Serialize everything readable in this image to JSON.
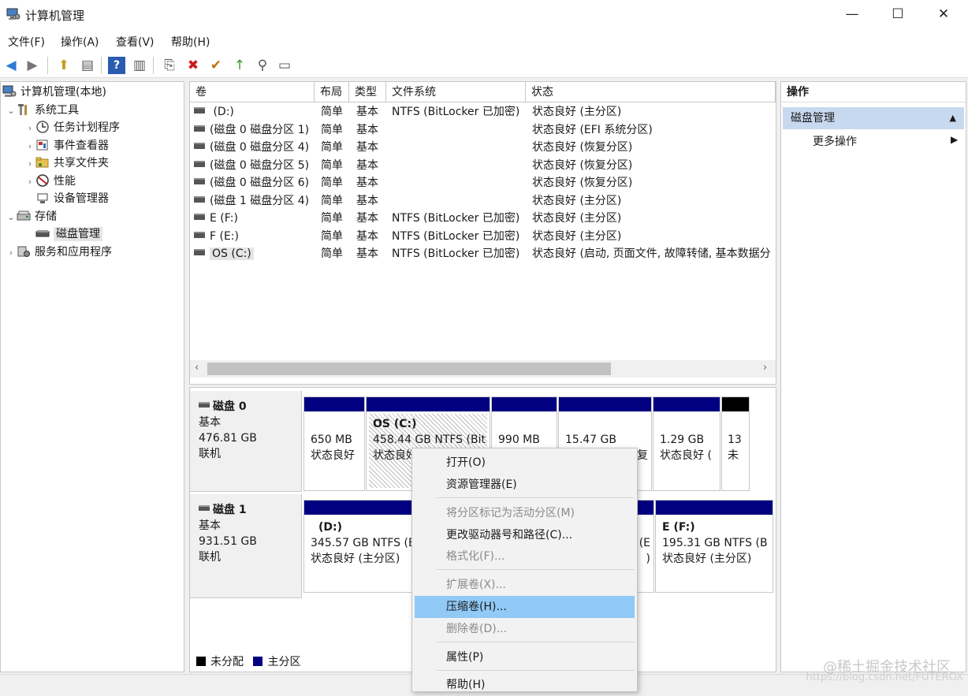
{
  "window": {
    "title": "计算机管理",
    "minimize": "—",
    "maximize": "☐",
    "close": "✕"
  },
  "menu": [
    "文件(F)",
    "操作(A)",
    "查看(V)",
    "帮助(H)"
  ],
  "toolbar": {
    "back": "◀",
    "forward": "▶",
    "up": "⬆",
    "show_hide": "▤",
    "help": "?",
    "view": "▥",
    "connect": "⎘",
    "delete": "✖",
    "properties": "✔",
    "export": "↑",
    "search": "⚲",
    "more": "▭"
  },
  "tree": {
    "root": "计算机管理(本地)",
    "system_tools": "系统工具",
    "task_scheduler": "任务计划程序",
    "event_viewer": "事件查看器",
    "shared_folders": "共享文件夹",
    "performance": "性能",
    "device_manager": "设备管理器",
    "storage": "存储",
    "disk_management": "磁盘管理",
    "services": "服务和应用程序"
  },
  "columns": [
    "卷",
    "布局",
    "类型",
    "文件系统",
    "状态"
  ],
  "volumes": [
    {
      "name": " (D:)",
      "layout": "简单",
      "type": "基本",
      "fs": "NTFS (BitLocker 已加密)",
      "status": "状态良好 (主分区)"
    },
    {
      "name": "(磁盘 0 磁盘分区 1)",
      "layout": "简单",
      "type": "基本",
      "fs": "",
      "status": "状态良好 (EFI 系统分区)"
    },
    {
      "name": "(磁盘 0 磁盘分区 4)",
      "layout": "简单",
      "type": "基本",
      "fs": "",
      "status": "状态良好 (恢复分区)"
    },
    {
      "name": "(磁盘 0 磁盘分区 5)",
      "layout": "简单",
      "type": "基本",
      "fs": "",
      "status": "状态良好 (恢复分区)"
    },
    {
      "name": "(磁盘 0 磁盘分区 6)",
      "layout": "简单",
      "type": "基本",
      "fs": "",
      "status": "状态良好 (恢复分区)"
    },
    {
      "name": "(磁盘 1 磁盘分区 4)",
      "layout": "简单",
      "type": "基本",
      "fs": "",
      "status": "状态良好 (主分区)"
    },
    {
      "name": "E (F:)",
      "layout": "简单",
      "type": "基本",
      "fs": "NTFS (BitLocker 已加密)",
      "status": "状态良好 (主分区)"
    },
    {
      "name": "F (E:)",
      "layout": "简单",
      "type": "基本",
      "fs": "NTFS (BitLocker 已加密)",
      "status": "状态良好 (主分区)"
    },
    {
      "name": "OS (C:)",
      "layout": "简单",
      "type": "基本",
      "fs": "NTFS (BitLocker 已加密)",
      "status": "状态良好 (启动, 页面文件, 故障转储, 基本数据分"
    }
  ],
  "disks": [
    {
      "name": "磁盘 0",
      "type": "基本",
      "size": "476.81 GB",
      "state": "联机",
      "partitions": [
        {
          "title": "",
          "line1": "650 MB",
          "line2": "状态良好"
        },
        {
          "title": "OS  (C:)",
          "line1": "458.44 GB NTFS (Bit",
          "line2": "状态良好"
        },
        {
          "title": "",
          "line1": "990 MB",
          "line2": ""
        },
        {
          "title": "",
          "line1": "15.47 GB",
          "line2": "复"
        },
        {
          "title": "",
          "line1": "1.29 GB",
          "line2": "状态良好 ("
        },
        {
          "title": "",
          "line1": "13",
          "line2": "未"
        }
      ]
    },
    {
      "name": "磁盘 1",
      "type": "基本",
      "size": "931.51 GB",
      "state": "联机",
      "partitions": [
        {
          "title": "(D:)",
          "line1": "345.57 GB NTFS (E",
          "line2": "状态良好 (主分区)"
        },
        {
          "title": "",
          "line1": "(E",
          "line2": ")"
        },
        {
          "title": "E  (F:)",
          "line1": "195.31 GB NTFS (B",
          "line2": "状态良好 (主分区)"
        }
      ]
    }
  ],
  "legend": {
    "unallocated": "未分配",
    "primary": "主分区"
  },
  "actions": {
    "header": "操作",
    "section": "磁盘管理",
    "more": "更多操作"
  },
  "context_menu": {
    "open": "打开(O)",
    "explorer": "资源管理器(E)",
    "mark_active": "将分区标记为活动分区(M)",
    "change_letter": "更改驱动器号和路径(C)...",
    "format": "格式化(F)...",
    "extend": "扩展卷(X)...",
    "shrink": "压缩卷(H)...",
    "delete": "删除卷(D)...",
    "properties": "属性(P)",
    "help": "帮助(H)"
  },
  "watermark": {
    "brand": "@稀土掘金技术社区",
    "url": "https://blog.csdn.net/FUTEROX"
  },
  "colors": {
    "primary_partition": "#000080",
    "unallocated": "#000000",
    "menu_highlight": "#91c9f7",
    "actions_section": "#c7d9ef"
  }
}
